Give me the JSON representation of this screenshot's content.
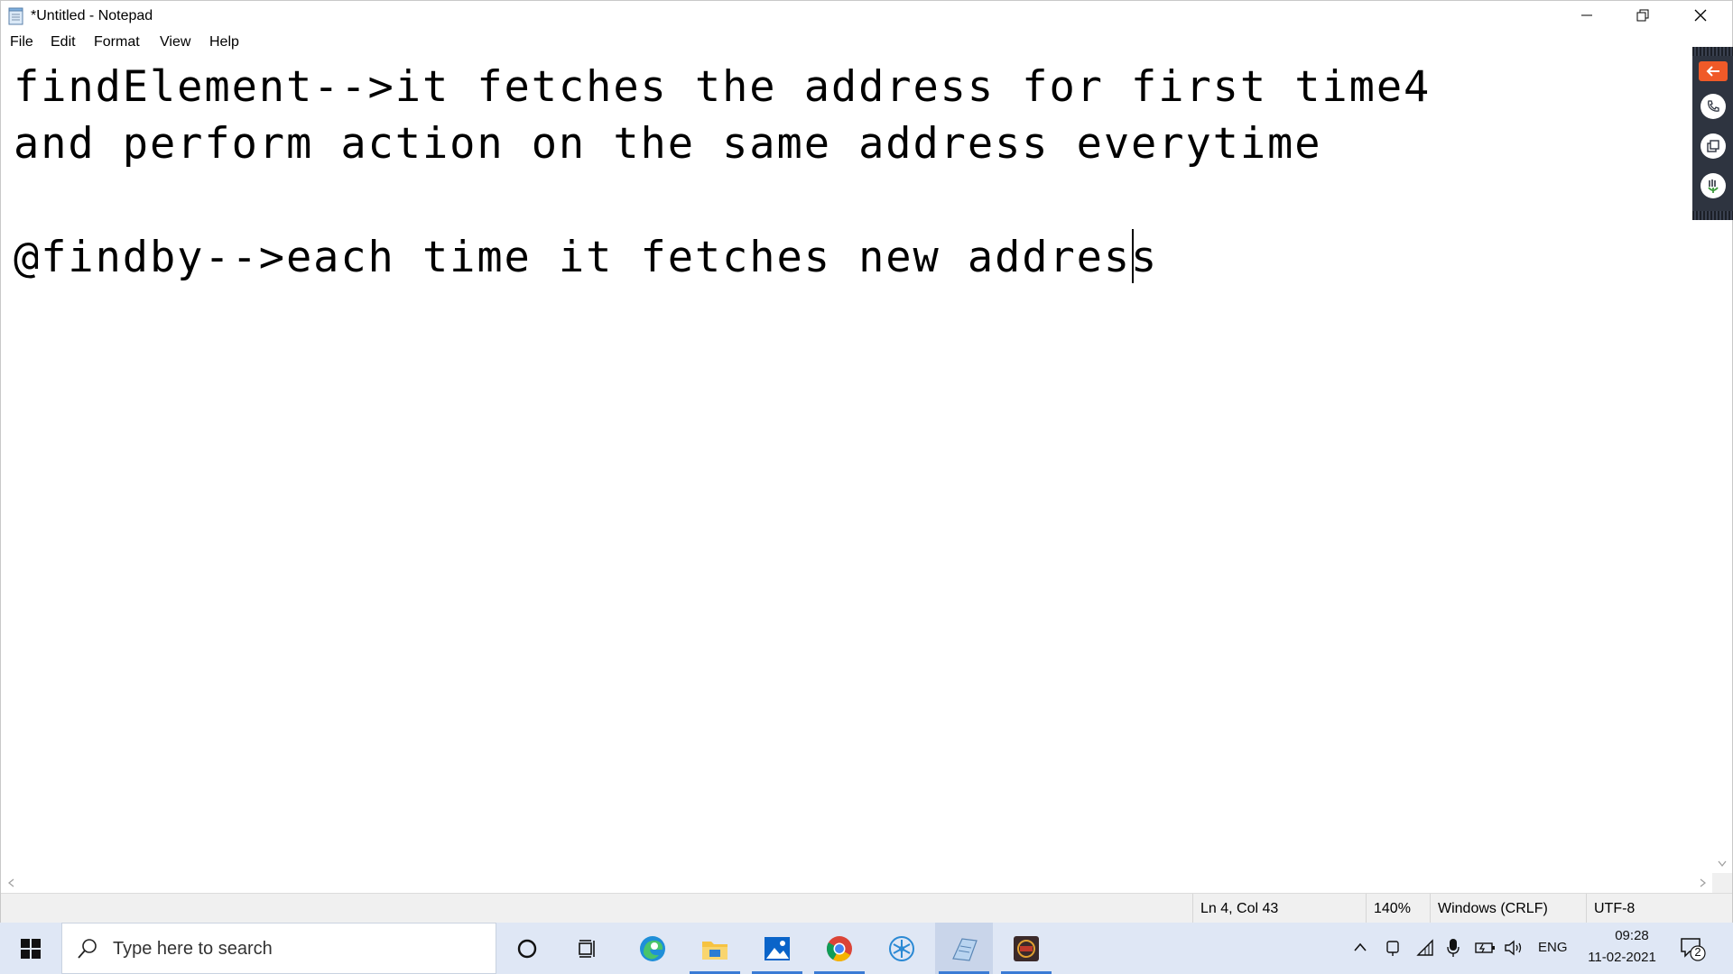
{
  "window": {
    "title": "*Untitled - Notepad",
    "controls": [
      "minimize",
      "restore",
      "close"
    ]
  },
  "menu": {
    "items": [
      {
        "label": "File"
      },
      {
        "label": "Edit"
      },
      {
        "label": "Format"
      },
      {
        "label": "View"
      },
      {
        "label": "Help"
      }
    ]
  },
  "editor": {
    "lines": [
      "findElement-->it fetches the address for first time4",
      "and perform action on the same address everytime",
      "",
      "@findby-->each time it fetches new address"
    ]
  },
  "status": {
    "position": "Ln 4, Col 43",
    "zoom": "140%",
    "line_ending": "Windows (CRLF)",
    "encoding": "UTF-8"
  },
  "side_panel": {
    "icons": [
      "arrow-left-icon",
      "phone-icon",
      "copy-icon",
      "touch-icon"
    ],
    "accent": "#f05a28"
  },
  "taskbar": {
    "search_placeholder": "Type here to search",
    "apps": [
      "cortana",
      "task-view",
      "edge",
      "file-explorer",
      "photos",
      "chrome",
      "app-settings",
      "notepad",
      "video-app"
    ],
    "tray": {
      "language": "ENG",
      "time": "09:28",
      "date": "11-02-2021",
      "notification_count": "2"
    },
    "accent": "#3a7bd5"
  }
}
